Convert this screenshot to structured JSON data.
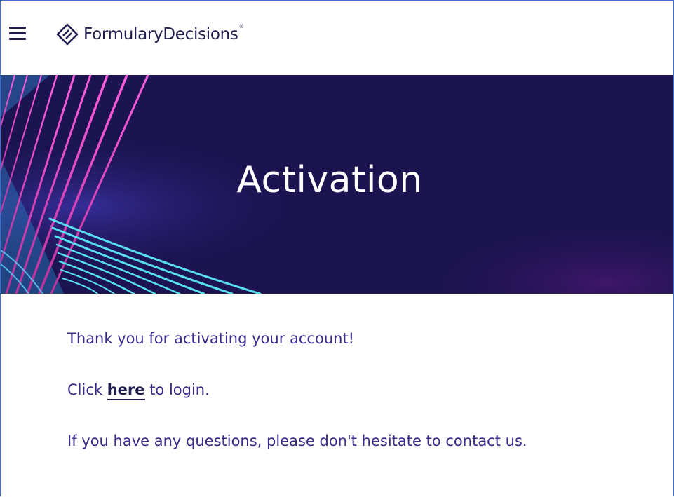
{
  "header": {
    "menu_icon": "hamburger-menu-icon",
    "logo_icon": "formulary-decisions-logo-mark",
    "logo_text": "FormularyDecisions",
    "logo_registered": "®"
  },
  "hero": {
    "title": "Activation"
  },
  "main": {
    "thanks": "Thank you for activating your account!",
    "login_prefix": "Click ",
    "login_link": "here",
    "login_suffix": " to login.",
    "questions": "If you have any questions, please don't hesitate to contact us."
  },
  "colors": {
    "navy": "#1e1c4d",
    "hero_bg": "#1b1450",
    "text_purple": "#3a2a8a",
    "accent_pink": "#e34bd6",
    "accent_cyan": "#4fd7ee",
    "border_blue": "#3d6fd1"
  }
}
